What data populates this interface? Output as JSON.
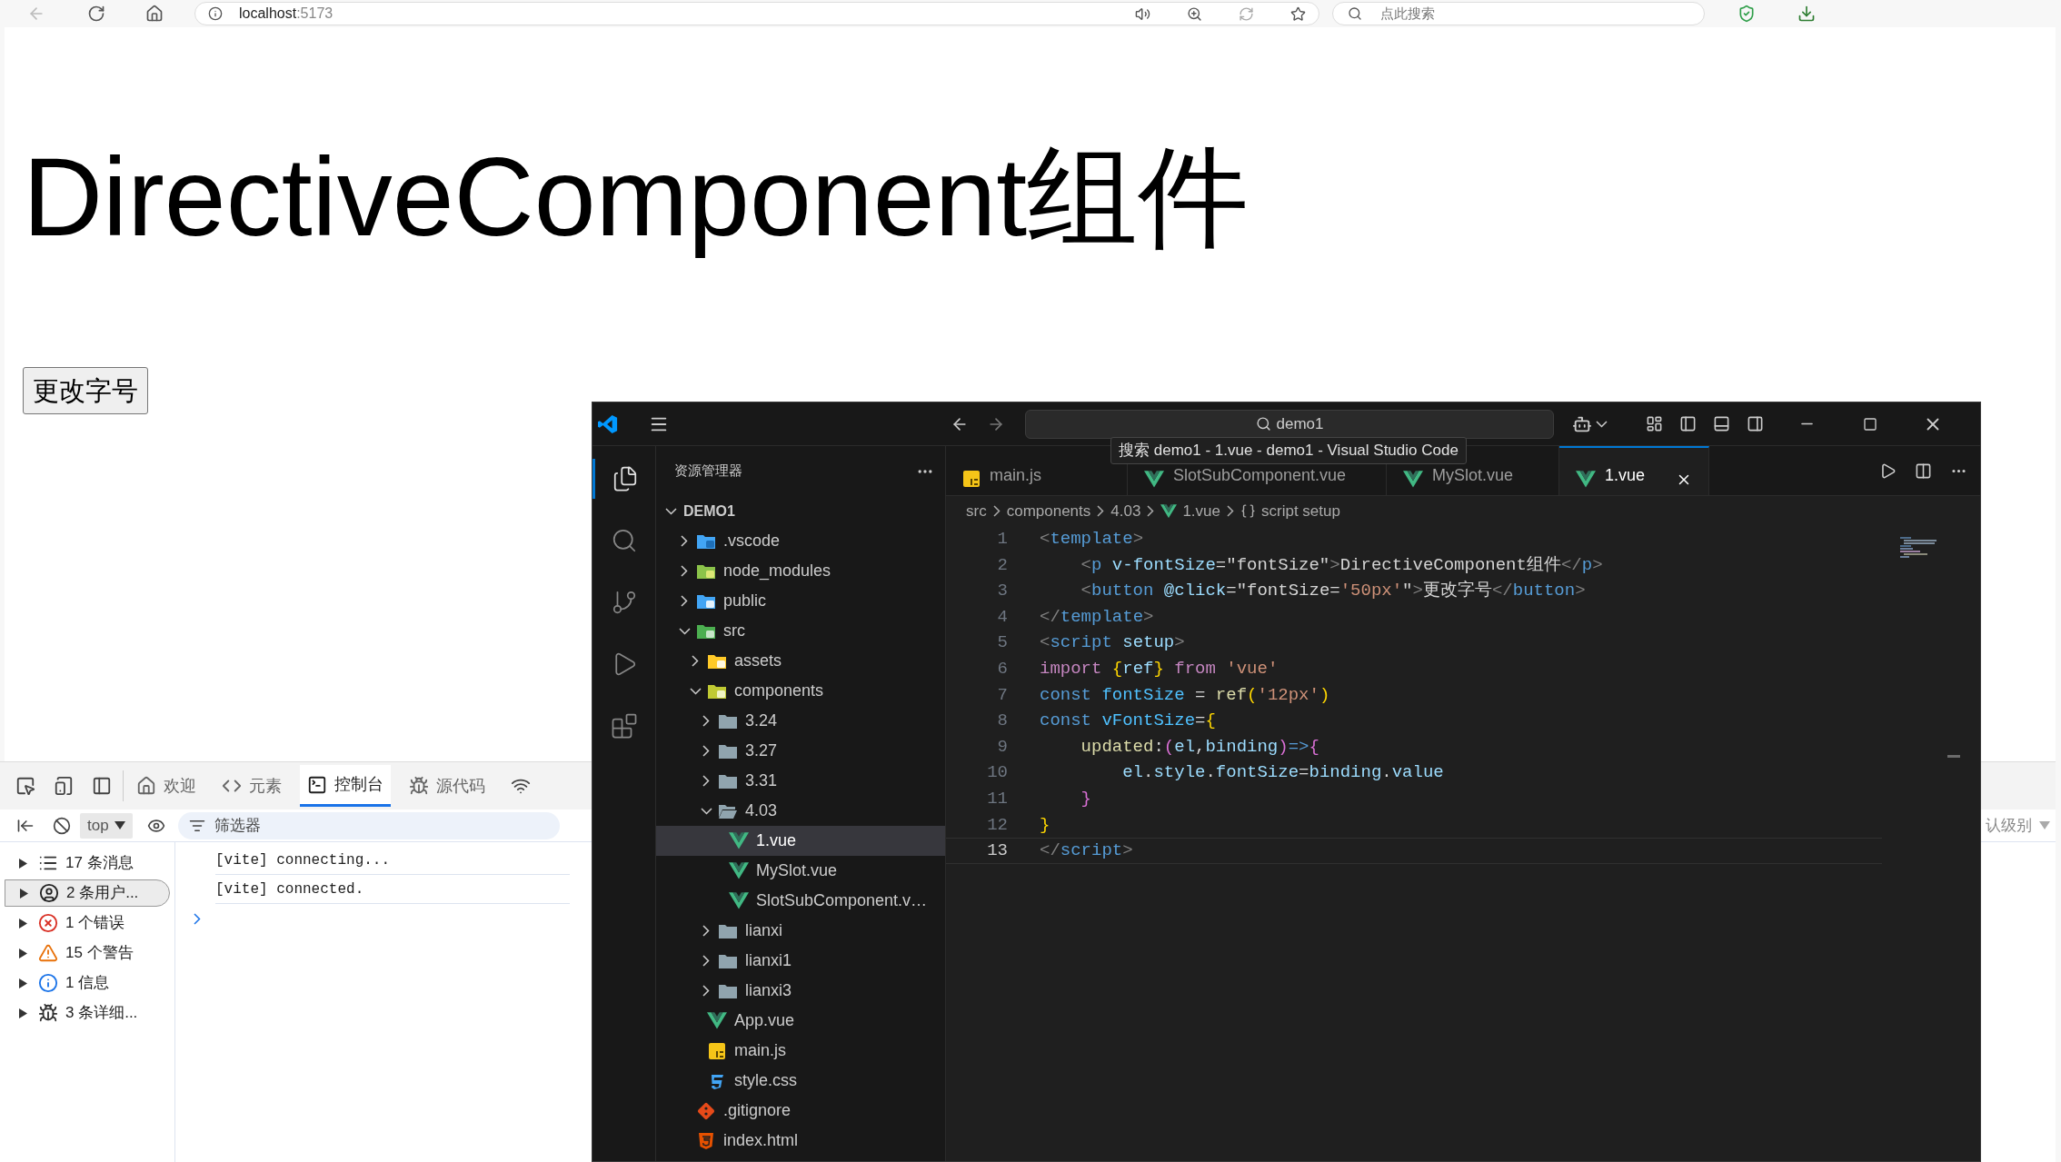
{
  "browser": {
    "address": "localhost",
    "port": ":5173",
    "search_placeholder": "点此搜索"
  },
  "page": {
    "heading": "DirectiveComponent组件",
    "button": "更改字号"
  },
  "devtools": {
    "tabs": [
      {
        "label": "欢迎",
        "selected": false
      },
      {
        "label": "元素",
        "selected": false
      },
      {
        "label": "控制台",
        "selected": true
      },
      {
        "label": "源代码",
        "selected": false
      }
    ],
    "context": "top",
    "filter_placeholder": "筛选器",
    "level_filter": "认级别",
    "sidebar": [
      {
        "label": "17 条消息",
        "kind": "messages",
        "selected": false
      },
      {
        "label": "2 条用户...",
        "kind": "user",
        "selected": true
      },
      {
        "label": "1 个错误",
        "kind": "error",
        "selected": false
      },
      {
        "label": "15 个警告",
        "kind": "warning",
        "selected": false
      },
      {
        "label": "1 信息",
        "kind": "info",
        "selected": false
      },
      {
        "label": "3 条详细...",
        "kind": "verbose",
        "selected": false
      }
    ],
    "logs": [
      "[vite] connecting...",
      "[vite] connected."
    ]
  },
  "vscode": {
    "command_center": "demo1",
    "tooltip": "搜索 demo1 - 1.vue - demo1 - Visual Studio Code",
    "activity_bar": [
      {
        "selected": true
      },
      {
        "selected": false
      },
      {
        "selected": false
      },
      {
        "selected": false
      },
      {
        "selected": false
      }
    ],
    "explorer": {
      "title": "资源管理器",
      "root": {
        "label": "DEMO1",
        "expanded": true
      },
      "tree": [
        {
          "label": ".vscode",
          "kind": "folder-vscode",
          "expanded": false,
          "selected": false
        },
        {
          "label": "node_modules",
          "kind": "folder-node",
          "expanded": false,
          "selected": false
        },
        {
          "label": "public",
          "kind": "folder-public",
          "expanded": false,
          "selected": false
        },
        {
          "label": "src",
          "kind": "folder-src",
          "expanded": true,
          "selected": false,
          "children": [
            {
              "label": "assets",
              "kind": "folder-assets",
              "expanded": false,
              "selected": false
            },
            {
              "label": "components",
              "kind": "folder-components",
              "expanded": true,
              "selected": false,
              "children": [
                {
                  "label": "3.24",
                  "kind": "folder",
                  "expanded": false,
                  "selected": false
                },
                {
                  "label": "3.27",
                  "kind": "folder",
                  "expanded": false,
                  "selected": false
                },
                {
                  "label": "3.31",
                  "kind": "folder",
                  "expanded": false,
                  "selected": false
                },
                {
                  "label": "4.03",
                  "kind": "folder",
                  "expanded": true,
                  "selected": false,
                  "children": [
                    {
                      "label": "1.vue",
                      "kind": "vue",
                      "selected": true
                    },
                    {
                      "label": "MySlot.vue",
                      "kind": "vue",
                      "selected": false
                    },
                    {
                      "label": "SlotSubComponent.v…",
                      "kind": "vue",
                      "selected": false
                    }
                  ]
                },
                {
                  "label": "lianxi",
                  "kind": "folder",
                  "expanded": false,
                  "selected": false
                },
                {
                  "label": "lianxi1",
                  "kind": "folder",
                  "expanded": false,
                  "selected": false
                },
                {
                  "label": "lianxi3",
                  "kind": "folder",
                  "expanded": false,
                  "selected": false
                }
              ]
            },
            {
              "label": "App.vue",
              "kind": "vue",
              "selected": false
            },
            {
              "label": "main.js",
              "kind": "js",
              "selected": false
            },
            {
              "label": "style.css",
              "kind": "css",
              "selected": false
            }
          ]
        },
        {
          "label": ".gitignore",
          "kind": "git",
          "selected": false
        },
        {
          "label": "index.html",
          "kind": "html",
          "selected": false
        }
      ]
    },
    "tabs": [
      {
        "label": "main.js",
        "kind": "js",
        "selected": false
      },
      {
        "label": "SlotSubComponent.vue",
        "kind": "vue",
        "selected": false
      },
      {
        "label": "MySlot.vue",
        "kind": "vue",
        "selected": false
      },
      {
        "label": "1.vue",
        "kind": "vue",
        "selected": true
      }
    ],
    "breadcrumbs": [
      {
        "label": "src",
        "kind": "folder"
      },
      {
        "label": "components",
        "kind": "folder"
      },
      {
        "label": "4.03",
        "kind": "folder"
      },
      {
        "label": "1.vue",
        "kind": "vue"
      },
      {
        "label": "script setup",
        "kind": "symbol"
      }
    ],
    "code": [
      {
        "number": "1",
        "current": false,
        "tokens": [
          {
            "text": "<",
            "kind": "punct"
          },
          {
            "text": "template",
            "kind": "tag"
          },
          {
            "text": ">",
            "kind": "punct"
          }
        ]
      },
      {
        "number": "2",
        "current": false,
        "tokens": [
          {
            "text": "    <",
            "kind": "punct"
          },
          {
            "text": "p",
            "kind": "tag"
          },
          {
            "text": " v-fontSize",
            "kind": "attr"
          },
          {
            "text": "=\"fontSize\"",
            "kind": "text"
          },
          {
            "text": ">",
            "kind": "punct"
          },
          {
            "text": "DirectiveComponent组件",
            "kind": "text"
          },
          {
            "text": "</",
            "kind": "punct"
          },
          {
            "text": "p",
            "kind": "tag"
          },
          {
            "text": ">",
            "kind": "punct"
          }
        ]
      },
      {
        "number": "3",
        "current": false,
        "tokens": [
          {
            "text": "    <",
            "kind": "punct"
          },
          {
            "text": "button",
            "kind": "tag"
          },
          {
            "text": " @click",
            "kind": "attr"
          },
          {
            "text": "=\"fontSize=",
            "kind": "text"
          },
          {
            "text": "'50px'",
            "kind": "string"
          },
          {
            "text": "\"",
            "kind": "text"
          },
          {
            "text": ">",
            "kind": "punct"
          },
          {
            "text": "更改字号",
            "kind": "text"
          },
          {
            "text": "</",
            "kind": "punct"
          },
          {
            "text": "button",
            "kind": "tag"
          },
          {
            "text": ">",
            "kind": "punct"
          }
        ]
      },
      {
        "number": "4",
        "current": false,
        "tokens": [
          {
            "text": "</",
            "kind": "punct"
          },
          {
            "text": "template",
            "kind": "tag"
          },
          {
            "text": ">",
            "kind": "punct"
          }
        ]
      },
      {
        "number": "5",
        "current": false,
        "tokens": [
          {
            "text": "<",
            "kind": "punct"
          },
          {
            "text": "script",
            "kind": "tag"
          },
          {
            "text": " setup",
            "kind": "attr"
          },
          {
            "text": ">",
            "kind": "punct"
          }
        ]
      },
      {
        "number": "6",
        "current": false,
        "tokens": [
          {
            "text": "import ",
            "kind": "keyword"
          },
          {
            "text": "{",
            "kind": "b1"
          },
          {
            "text": "ref",
            "kind": "var"
          },
          {
            "text": "}",
            "kind": "b1"
          },
          {
            "text": " from ",
            "kind": "keyword"
          },
          {
            "text": "'vue'",
            "kind": "string"
          }
        ]
      },
      {
        "number": "7",
        "current": false,
        "tokens": [
          {
            "text": "const",
            "kind": "storage"
          },
          {
            "text": " fontSize",
            "kind": "const"
          },
          {
            "text": " = ",
            "kind": "text"
          },
          {
            "text": "ref",
            "kind": "func"
          },
          {
            "text": "(",
            "kind": "b1"
          },
          {
            "text": "'12px'",
            "kind": "string"
          },
          {
            "text": ")",
            "kind": "b1"
          }
        ]
      },
      {
        "number": "8",
        "current": false,
        "tokens": [
          {
            "text": "const",
            "kind": "storage"
          },
          {
            "text": " vFontSize",
            "kind": "const"
          },
          {
            "text": "=",
            "kind": "text"
          },
          {
            "text": "{",
            "kind": "b1"
          }
        ]
      },
      {
        "number": "9",
        "current": false,
        "tokens": [
          {
            "text": "    updated",
            "kind": "func"
          },
          {
            "text": ":",
            "kind": "text"
          },
          {
            "text": "(",
            "kind": "b2"
          },
          {
            "text": "el",
            "kind": "var"
          },
          {
            "text": ",",
            "kind": "text"
          },
          {
            "text": "binding",
            "kind": "var"
          },
          {
            "text": ")",
            "kind": "b2"
          },
          {
            "text": "=>",
            "kind": "storage"
          },
          {
            "text": "{",
            "kind": "b2"
          }
        ]
      },
      {
        "number": "10",
        "current": false,
        "tokens": [
          {
            "text": "        el",
            "kind": "var"
          },
          {
            "text": ".",
            "kind": "text"
          },
          {
            "text": "style",
            "kind": "var"
          },
          {
            "text": ".",
            "kind": "text"
          },
          {
            "text": "fontSize",
            "kind": "var"
          },
          {
            "text": "=",
            "kind": "text"
          },
          {
            "text": "binding",
            "kind": "var"
          },
          {
            "text": ".",
            "kind": "text"
          },
          {
            "text": "value",
            "kind": "var"
          }
        ]
      },
      {
        "number": "11",
        "current": false,
        "tokens": [
          {
            "text": "    }",
            "kind": "b2"
          }
        ]
      },
      {
        "number": "12",
        "current": false,
        "tokens": [
          {
            "text": "}",
            "kind": "b1"
          }
        ]
      },
      {
        "number": "13",
        "current": true,
        "tokens": [
          {
            "text": "</",
            "kind": "punct"
          },
          {
            "text": "script",
            "kind": "tag"
          },
          {
            "text": ">",
            "kind": "punct"
          }
        ]
      }
    ]
  }
}
